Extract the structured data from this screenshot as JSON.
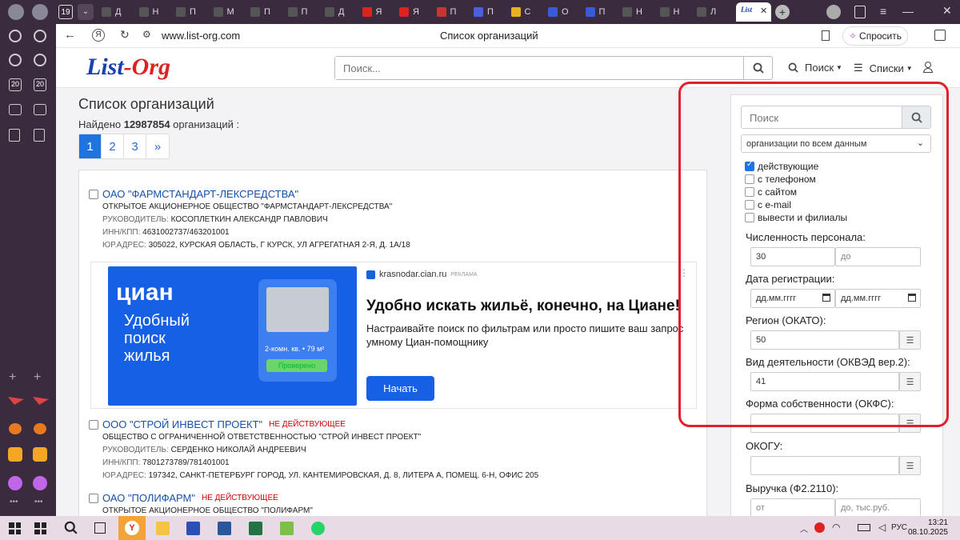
{
  "browser": {
    "tab_count": "19",
    "tabs": [
      {
        "label": "Д",
        "color": "#ddd"
      },
      {
        "label": "Н",
        "color": "#ddd"
      },
      {
        "label": "П",
        "color": "#ddd"
      },
      {
        "label": "М",
        "color": "#ddd"
      },
      {
        "label": "П",
        "color": "#ddd"
      },
      {
        "label": "П",
        "color": "#ddd"
      },
      {
        "label": "Д",
        "color": "#ddd"
      },
      {
        "label": "Я",
        "color": "#ddd"
      },
      {
        "label": "Я",
        "color": "#ddd"
      },
      {
        "label": "П",
        "color": "#ddd"
      },
      {
        "label": "П",
        "color": "#ddd"
      },
      {
        "label": "С",
        "color": "#ddd"
      },
      {
        "label": "О",
        "color": "#ddd"
      },
      {
        "label": "П",
        "color": "#ddd"
      },
      {
        "label": "Н",
        "color": "#ddd"
      },
      {
        "label": "Н",
        "color": "#ddd"
      },
      {
        "label": "Л",
        "color": "#ddd"
      }
    ],
    "url": "www.list-org.com",
    "page_title": "Список организаций",
    "ask_label": "Спросить"
  },
  "site": {
    "logo_part1": "List",
    "logo_dash": "-",
    "logo_part2": "Org",
    "search_placeholder": "Поиск...",
    "nav_search": "Поиск",
    "nav_lists": "Списки"
  },
  "main": {
    "title": "Список организаций",
    "found_prefix": "Найдено ",
    "found_count": "12987854",
    "found_suffix": " организаций :",
    "pages": [
      "1",
      "2",
      "3",
      "»"
    ],
    "orgs": [
      {
        "name": "ОАО \"ФАРМСТАНДАРТ-ЛЕКСРЕДСТВА\"",
        "status": "",
        "full_name": "ОТКРЫТОЕ АКЦИОНЕРНОЕ ОБЩЕСТВО \"ФАРМСТАНДАРТ-ЛЕКСРЕДСТВА\"",
        "head_label": "РУКОВОДИТЕЛЬ:",
        "head": "КОСОПЛЕТКИН АЛЕКСАНДР ПАВЛОВИЧ",
        "inn_label": "ИНН/КПП:",
        "inn": "4631002737/463201001",
        "addr_label": "ЮР.АДРЕС:",
        "addr": "305022, КУРСКАЯ ОБЛАСТЬ, Г КУРСК, УЛ АГРЕГАТНАЯ 2-Я, Д. 1А/18"
      },
      {
        "name": "ООО \"СТРОЙ ИНВЕСТ ПРОЕКТ\"",
        "status": "НЕ ДЕЙСТВУЮЩЕЕ",
        "full_name": "ОБЩЕСТВО С ОГРАНИЧЕННОЙ ОТВЕТСТВЕННОСТЬЮ \"СТРОЙ ИНВЕСТ ПРОЕКТ\"",
        "head_label": "РУКОВОДИТЕЛЬ:",
        "head": "СЕРДЕНКО НИКОЛАЙ АНДРЕЕВИЧ",
        "inn_label": "ИНН/КПП:",
        "inn": "7801273789/781401001",
        "addr_label": "ЮР.АДРЕС:",
        "addr": "197342, САНКТ-ПЕТЕРБУРГ ГОРОД, УЛ. КАНТЕМИРОВСКАЯ, Д. 8, ЛИТЕРА А, ПОМЕЩ. 6-Н, ОФИС 205"
      },
      {
        "name": "ОАО \"ПОЛИФАРМ\"",
        "status": "НЕ ДЕЙСТВУЮЩЕЕ",
        "full_name": "ОТКРЫТОЕ АКЦИОНЕРНОЕ ОБЩЕСТВО \"ПОЛИФАРМ\""
      }
    ],
    "ad": {
      "source": "krasnodar.cian.ru",
      "source_tag": "РЕКЛАМА",
      "brand": "циан",
      "banner_text": "Удобный поиск жилья",
      "card_text": "2-комн. кв. • 79 м²",
      "card_badge": "Проверено",
      "title": "Удобно искать жильё, конечно, на Циане!",
      "text": "Настраивайте поиск по фильтрам или просто пишите ваш запрос умному Циан-помощнику",
      "button": "Начать"
    }
  },
  "filters": {
    "search_placeholder": "Поиск",
    "select_value": "организации по всем данным",
    "checkboxes": [
      {
        "label": "действующие",
        "checked": true
      },
      {
        "label": "с телефоном",
        "checked": false
      },
      {
        "label": "с сайтом",
        "checked": false
      },
      {
        "label": "с e-mail",
        "checked": false
      },
      {
        "label": "вывести и филиалы",
        "checked": false
      }
    ],
    "staff_label": "Численность персонала:",
    "staff_from": "30",
    "staff_to_placeholder": "до",
    "reg_label": "Дата регистрации:",
    "date_placeholder": "дд.мм.гггг",
    "region_label": "Регион (ОКАТО):",
    "region_value": "50",
    "activity_label": "Вид деятельности (ОКВЭД вер.2):",
    "activity_value": "41",
    "ownership_label": "Форма собственности (ОКФС):",
    "okogu_label": "ОКОГУ:",
    "revenue_label": "Выручка (Ф2.2110):",
    "revenue_from_placeholder": "от",
    "revenue_to_placeholder": "до, тыс.руб."
  },
  "taskbar": {
    "lang": "РУС",
    "time": "13:21",
    "date": "08.10.2025"
  },
  "colors": {
    "accent": "#1f74e0",
    "frame": "#e0202a",
    "link": "#1650a8",
    "inactive": "#cc0000"
  }
}
